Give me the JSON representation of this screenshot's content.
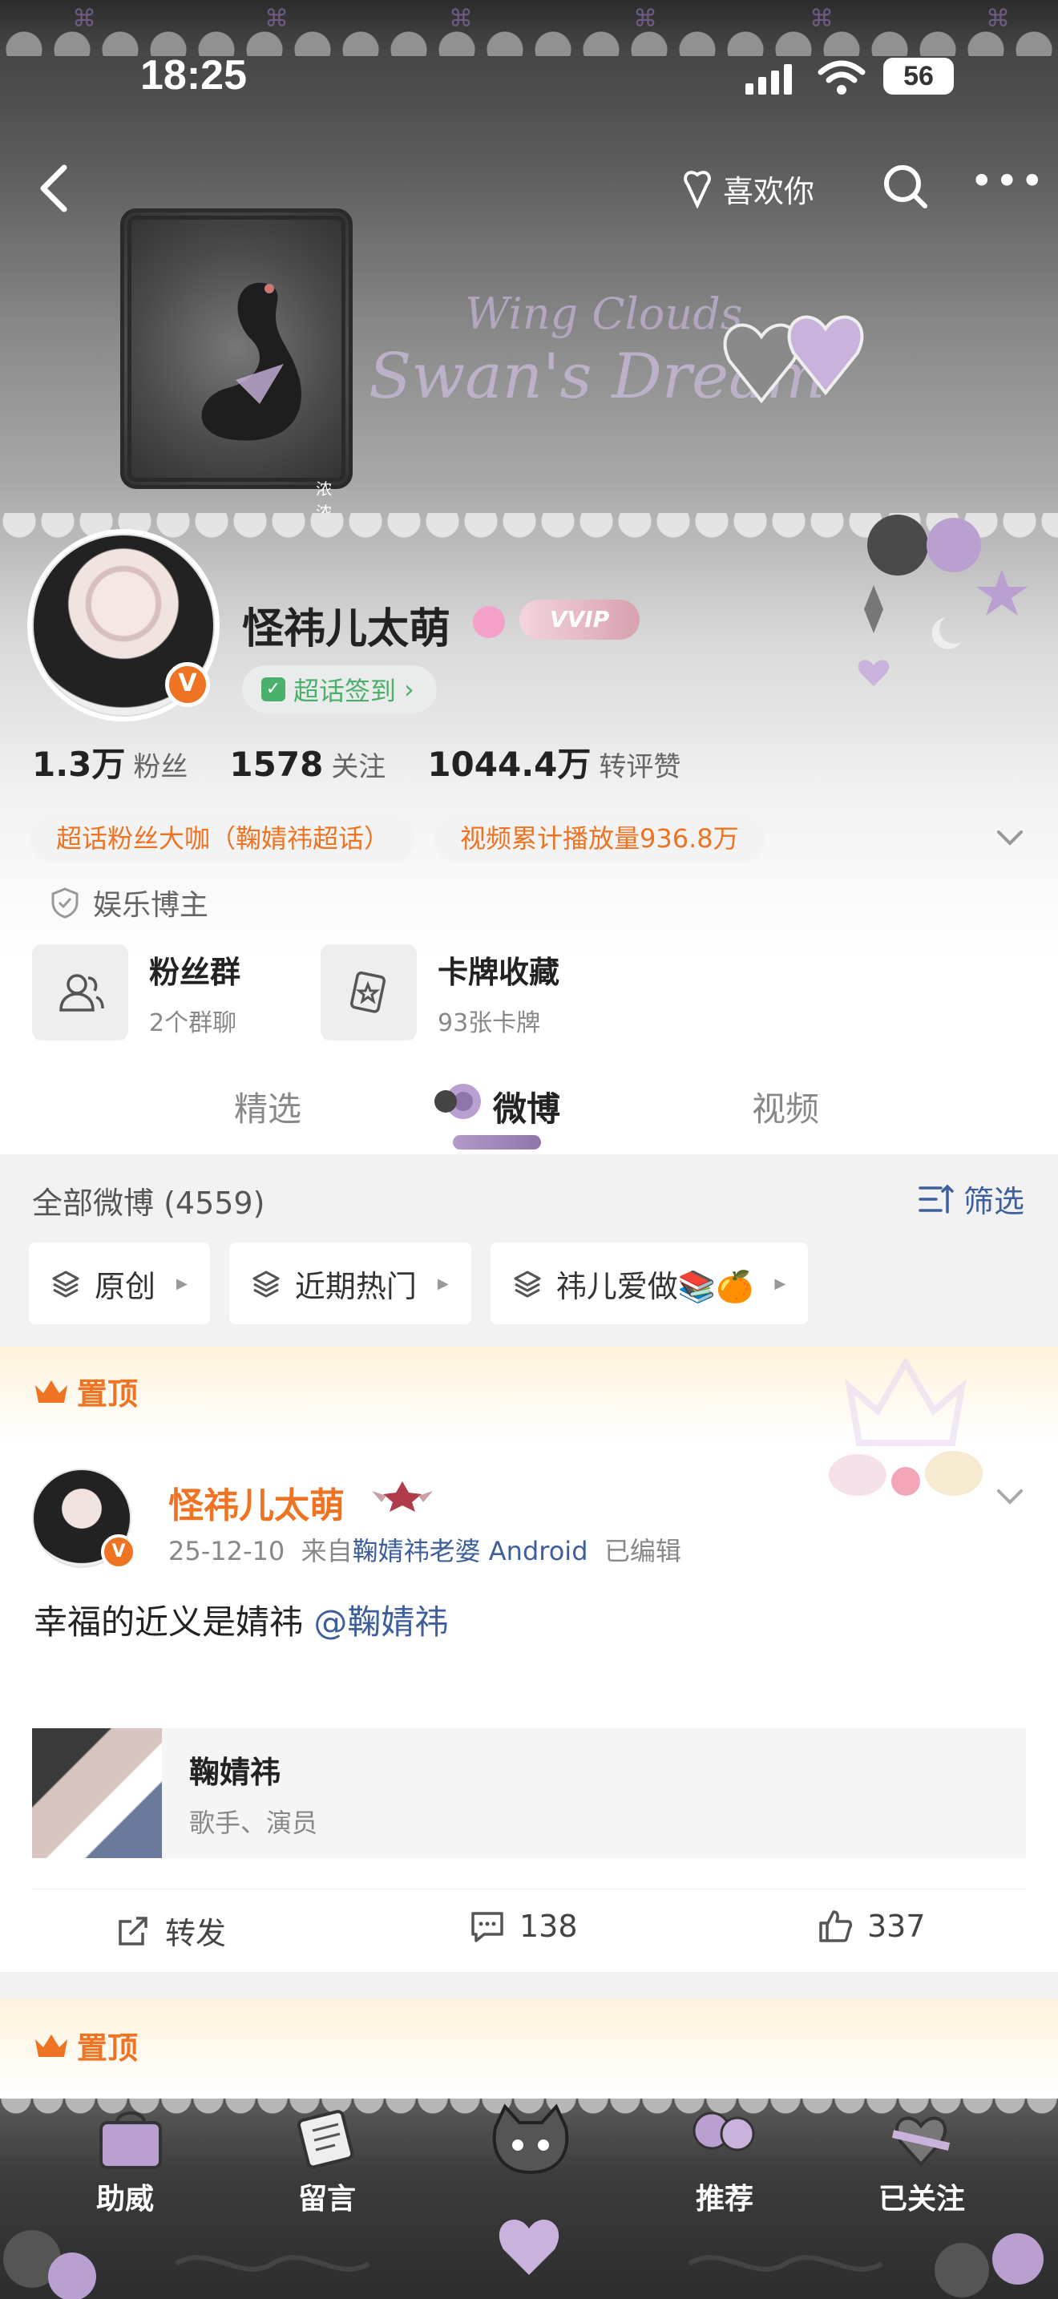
{
  "status_bar": {
    "time": "18:25",
    "battery": "56"
  },
  "nav": {
    "like_label": "喜欢你"
  },
  "banner": {
    "script_line1": "Wing Clouds",
    "script_line2": "Swan's Dream",
    "sticker_text": "浓浓"
  },
  "profile": {
    "name": "怪祎儿太萌",
    "vip_badge": "VVIP",
    "checkin_label": "超话签到",
    "stats": [
      {
        "num": "1.3万",
        "label": "粉丝"
      },
      {
        "num": "1578",
        "label": "关注"
      },
      {
        "num": "1044.4万",
        "label": "转评赞"
      }
    ],
    "tags": [
      "超话粉丝大咖（鞠婧祎超话）",
      "视频累计播放量936.8万"
    ],
    "category": "娱乐博主",
    "cards": [
      {
        "title": "粉丝群",
        "sub": "2个群聊"
      },
      {
        "title": "卡牌收藏",
        "sub": "93张卡牌"
      }
    ]
  },
  "tabs": [
    {
      "label": "精选"
    },
    {
      "label": "微博"
    },
    {
      "label": "视频"
    }
  ],
  "feed": {
    "title": "全部微博 (4559)",
    "filter_label": "筛选",
    "chips": [
      "原创",
      "近期热门",
      "祎儿爱做📚🍊"
    ]
  },
  "post": {
    "pin_label": "置顶",
    "author": "怪祎儿太萌",
    "date": "25-12-10",
    "from_prefix": "来自",
    "source": "鞠婧祎老婆 Android",
    "edited": "已编辑",
    "text": "幸福的近义是婧祎",
    "mention": "@鞠婧祎",
    "card": {
      "title": "鞠婧祎",
      "sub": "歌手、演员"
    },
    "actions": {
      "repost": "转发",
      "comments": "138",
      "likes": "337"
    }
  },
  "post2": {
    "pin_label": "置顶"
  },
  "bottom_bar": {
    "items": [
      "助威",
      "留言",
      "推荐",
      "已关注"
    ]
  },
  "colors": {
    "accent": "#ee7322",
    "link": "#3f5f9c",
    "check_green": "#4ab06c"
  }
}
